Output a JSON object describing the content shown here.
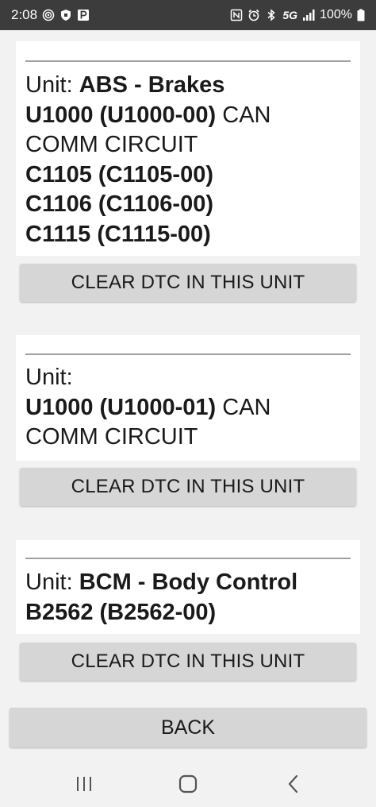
{
  "status_bar": {
    "time": "2:08",
    "network": "5G",
    "battery": "100%"
  },
  "units": [
    {
      "unit_prefix": "Unit: ",
      "unit_name": "ABS - Brakes",
      "codes": [
        {
          "code": "U1000 (U1000-00)",
          "desc_first": " CAN",
          "desc_second": "COMM CIRCUIT"
        },
        {
          "code": "C1105 (C1105-00)"
        },
        {
          "code": "C1106 (C1106-00)"
        },
        {
          "code": "C1115 (C1115-00)"
        }
      ],
      "clear_label": "CLEAR DTC IN THIS UNIT"
    },
    {
      "unit_prefix": "Unit: ",
      "unit_name": "",
      "codes": [
        {
          "code": "U1000 (U1000-01)",
          "desc_first": " CAN",
          "desc_second": "COMM CIRCUIT"
        }
      ],
      "clear_label": "CLEAR DTC IN THIS UNIT"
    },
    {
      "unit_prefix": "Unit: ",
      "unit_name": "BCM - Body Control",
      "codes": [
        {
          "code": "B2562 (B2562-00)"
        }
      ],
      "clear_label": "CLEAR DTC IN THIS UNIT"
    }
  ],
  "back_label": "BACK",
  "icons": {
    "nav_recent": "recent-apps-icon",
    "nav_home": "home-icon",
    "nav_back": "back-arrow-icon"
  }
}
